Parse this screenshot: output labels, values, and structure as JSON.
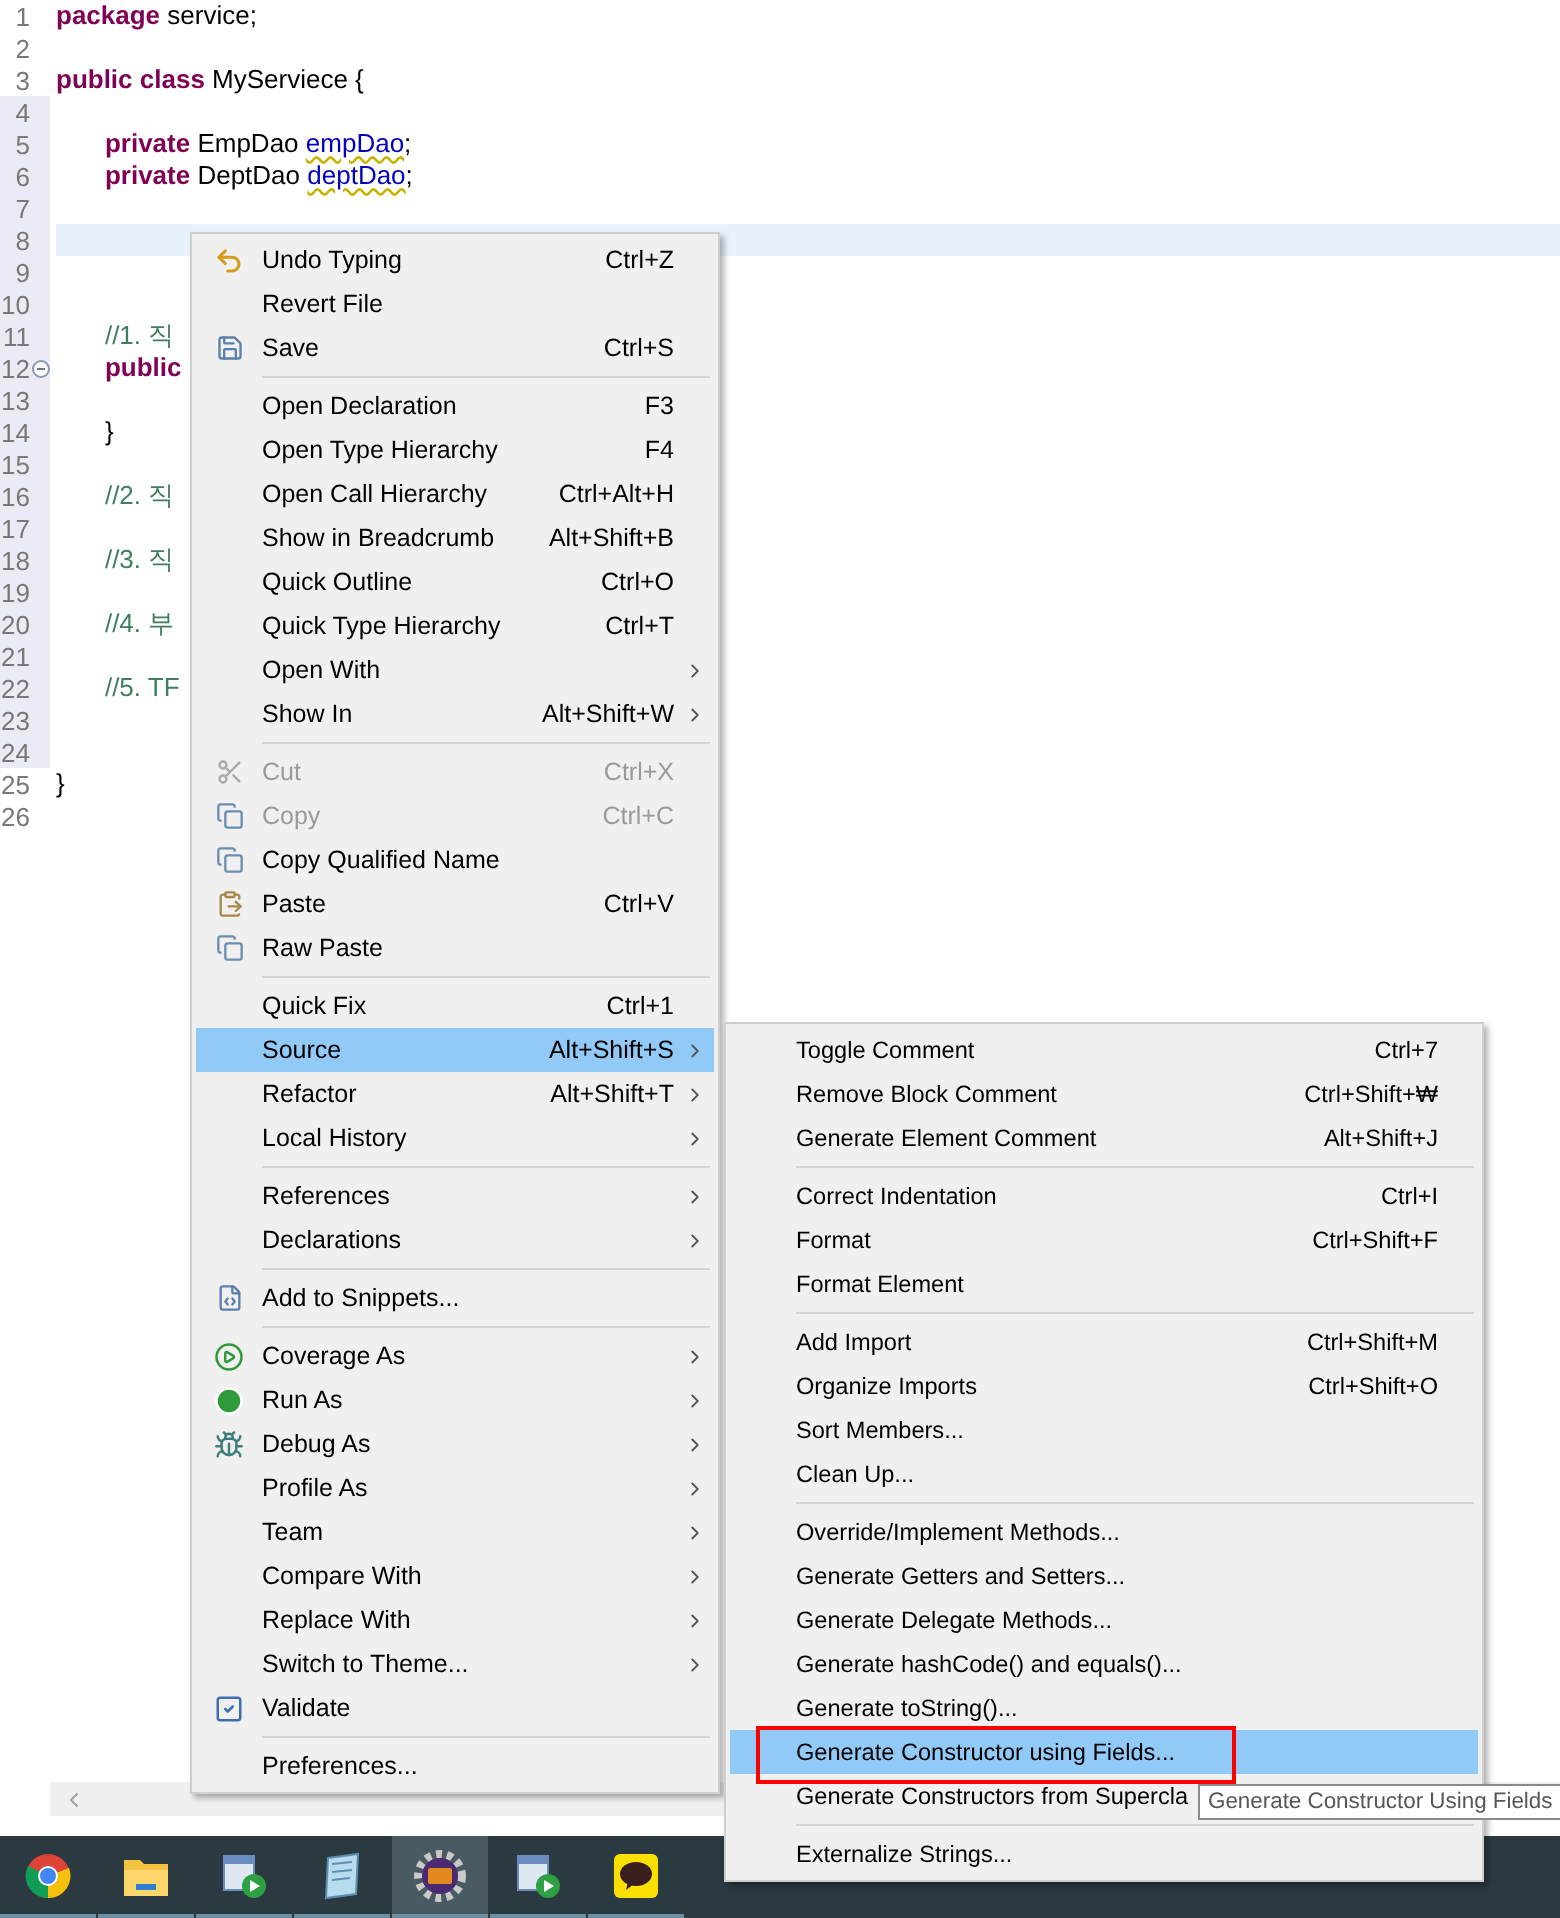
{
  "editor": {
    "lines": [
      {
        "number": "1",
        "changed": false,
        "current": false,
        "fold": false,
        "tokens": [
          {
            "text": "package",
            "kind": "keyword"
          },
          {
            "text": " service;",
            "kind": "plain"
          }
        ]
      },
      {
        "number": "2",
        "changed": false,
        "current": false,
        "fold": false
      },
      {
        "number": "3",
        "changed": false,
        "current": false,
        "fold": false,
        "tokens": [
          {
            "text": "public class",
            "kind": "keyword"
          },
          {
            "text": " MyServiece {",
            "kind": "plain"
          }
        ]
      },
      {
        "number": "4",
        "changed": true,
        "current": false,
        "fold": false
      },
      {
        "number": "5",
        "changed": true,
        "current": false,
        "fold": false,
        "tokens": [
          {
            "text": "\tprivate",
            "kind": "keyword"
          },
          {
            "text": " EmpDao ",
            "kind": "plain"
          },
          {
            "text": "empDao",
            "kind": "warn-field"
          },
          {
            "text": ";",
            "kind": "plain"
          }
        ]
      },
      {
        "number": "6",
        "changed": true,
        "current": false,
        "fold": false,
        "tokens": [
          {
            "text": "\tprivate",
            "kind": "keyword"
          },
          {
            "text": " DeptDao ",
            "kind": "plain"
          },
          {
            "text": "deptDao",
            "kind": "warn-field"
          },
          {
            "text": ";",
            "kind": "plain"
          }
        ]
      },
      {
        "number": "7",
        "changed": true,
        "current": false,
        "fold": false
      },
      {
        "number": "8",
        "changed": true,
        "current": true,
        "fold": false
      },
      {
        "number": "9",
        "changed": true,
        "current": false,
        "fold": false
      },
      {
        "number": "10",
        "changed": true,
        "current": false,
        "fold": false
      },
      {
        "number": "11",
        "changed": true,
        "current": false,
        "fold": false,
        "tokens": [
          {
            "text": "\t//1. 직",
            "kind": "comment"
          }
        ]
      },
      {
        "number": "12",
        "changed": true,
        "current": false,
        "fold": true,
        "tokens": [
          {
            "text": "\tpublic",
            "kind": "keyword"
          }
        ]
      },
      {
        "number": "13",
        "changed": true,
        "current": false,
        "fold": false
      },
      {
        "number": "14",
        "changed": true,
        "current": false,
        "fold": false,
        "tokens": [
          {
            "text": "\t}",
            "kind": "plain"
          }
        ]
      },
      {
        "number": "15",
        "changed": true,
        "current": false,
        "fold": false
      },
      {
        "number": "16",
        "changed": true,
        "current": false,
        "fold": false,
        "tokens": [
          {
            "text": "\t//2. 직",
            "kind": "comment"
          }
        ]
      },
      {
        "number": "17",
        "changed": true,
        "current": false,
        "fold": false
      },
      {
        "number": "18",
        "changed": true,
        "current": false,
        "fold": false,
        "tokens": [
          {
            "text": "\t//3. 직",
            "kind": "comment"
          }
        ]
      },
      {
        "number": "19",
        "changed": true,
        "current": false,
        "fold": false
      },
      {
        "number": "20",
        "changed": true,
        "current": false,
        "fold": false,
        "tokens": [
          {
            "text": "\t//4. 부",
            "kind": "comment"
          }
        ]
      },
      {
        "number": "21",
        "changed": true,
        "current": false,
        "fold": false
      },
      {
        "number": "22",
        "changed": true,
        "current": false,
        "fold": false,
        "tokens": [
          {
            "text": "\t//5. TF",
            "kind": "comment"
          }
        ]
      },
      {
        "number": "23",
        "changed": true,
        "current": false,
        "fold": false
      },
      {
        "number": "24",
        "changed": true,
        "current": false,
        "fold": false
      },
      {
        "number": "25",
        "changed": false,
        "current": false,
        "fold": false,
        "tokens": [
          {
            "text": "}",
            "kind": "plain"
          }
        ]
      },
      {
        "number": "26",
        "changed": false,
        "current": false,
        "fold": false
      }
    ]
  },
  "context_menu": [
    {
      "kind": "item",
      "label": "Undo Typing",
      "shortcut": "Ctrl+Z",
      "disabled": false,
      "selected": false,
      "submenu": false
    },
    {
      "kind": "item",
      "label": "Revert File",
      "disabled": false,
      "selected": false,
      "submenu": false
    },
    {
      "kind": "item",
      "label": "Save",
      "shortcut": "Ctrl+S",
      "disabled": false,
      "selected": false,
      "submenu": false
    },
    {
      "kind": "separator"
    },
    {
      "kind": "item",
      "label": "Open Declaration",
      "shortcut": "F3",
      "disabled": false,
      "selected": false,
      "submenu": false
    },
    {
      "kind": "item",
      "label": "Open Type Hierarchy",
      "shortcut": "F4",
      "disabled": false,
      "selected": false,
      "submenu": false
    },
    {
      "kind": "item",
      "label": "Open Call Hierarchy",
      "shortcut": "Ctrl+Alt+H",
      "disabled": false,
      "selected": false,
      "submenu": false
    },
    {
      "kind": "item",
      "label": "Show in Breadcrumb",
      "shortcut": "Alt+Shift+B",
      "disabled": false,
      "selected": false,
      "submenu": false
    },
    {
      "kind": "item",
      "label": "Quick Outline",
      "shortcut": "Ctrl+O",
      "disabled": false,
      "selected": false,
      "submenu": false
    },
    {
      "kind": "item",
      "label": "Quick Type Hierarchy",
      "shortcut": "Ctrl+T",
      "disabled": false,
      "selected": false,
      "submenu": false
    },
    {
      "kind": "item",
      "label": "Open With",
      "disabled": false,
      "selected": false,
      "submenu": true
    },
    {
      "kind": "item",
      "label": "Show In",
      "shortcut": "Alt+Shift+W",
      "disabled": false,
      "selected": false,
      "submenu": true
    },
    {
      "kind": "separator"
    },
    {
      "kind": "item",
      "label": "Cut",
      "shortcut": "Ctrl+X",
      "disabled": true,
      "selected": false,
      "submenu": false
    },
    {
      "kind": "item",
      "label": "Copy",
      "shortcut": "Ctrl+C",
      "disabled": true,
      "selected": false,
      "submenu": false
    },
    {
      "kind": "item",
      "label": "Copy Qualified Name",
      "disabled": false,
      "selected": false,
      "submenu": false
    },
    {
      "kind": "item",
      "label": "Paste",
      "shortcut": "Ctrl+V",
      "disabled": false,
      "selected": false,
      "submenu": false
    },
    {
      "kind": "item",
      "label": "Raw Paste",
      "disabled": false,
      "selected": false,
      "submenu": false
    },
    {
      "kind": "separator"
    },
    {
      "kind": "item",
      "label": "Quick Fix",
      "shortcut": "Ctrl+1",
      "disabled": false,
      "selected": false,
      "submenu": false
    },
    {
      "kind": "item",
      "label": "Source",
      "shortcut": "Alt+Shift+S",
      "disabled": false,
      "selected": true,
      "submenu": true
    },
    {
      "kind": "item",
      "label": "Refactor",
      "shortcut": "Alt+Shift+T",
      "disabled": false,
      "selected": false,
      "submenu": true
    },
    {
      "kind": "item",
      "label": "Local History",
      "disabled": false,
      "selected": false,
      "submenu": true
    },
    {
      "kind": "separator"
    },
    {
      "kind": "item",
      "label": "References",
      "disabled": false,
      "selected": false,
      "submenu": true
    },
    {
      "kind": "item",
      "label": "Declarations",
      "disabled": false,
      "selected": false,
      "submenu": true
    },
    {
      "kind": "separator"
    },
    {
      "kind": "item",
      "label": "Add to Snippets...",
      "disabled": false,
      "selected": false,
      "submenu": false
    },
    {
      "kind": "separator"
    },
    {
      "kind": "item",
      "label": "Coverage As",
      "disabled": false,
      "selected": false,
      "submenu": true
    },
    {
      "kind": "item",
      "label": "Run As",
      "disabled": false,
      "selected": false,
      "submenu": true
    },
    {
      "kind": "item",
      "label": "Debug As",
      "disabled": false,
      "selected": false,
      "submenu": true
    },
    {
      "kind": "item",
      "label": "Profile As",
      "disabled": false,
      "selected": false,
      "submenu": true
    },
    {
      "kind": "item",
      "label": "Team",
      "disabled": false,
      "selected": false,
      "submenu": true
    },
    {
      "kind": "item",
      "label": "Compare With",
      "disabled": false,
      "selected": false,
      "submenu": true
    },
    {
      "kind": "item",
      "label": "Replace With",
      "disabled": false,
      "selected": false,
      "submenu": true
    },
    {
      "kind": "item",
      "label": "Switch to Theme...",
      "disabled": false,
      "selected": false,
      "submenu": true
    },
    {
      "kind": "check",
      "label": "Validate",
      "checked": true,
      "disabled": false,
      "selected": false,
      "submenu": false
    },
    {
      "kind": "separator"
    },
    {
      "kind": "item",
      "label": "Preferences...",
      "disabled": false,
      "selected": false,
      "submenu": false
    }
  ],
  "source_submenu": [
    {
      "kind": "item",
      "label": "Toggle Comment",
      "shortcut": "Ctrl+7",
      "selected": false
    },
    {
      "kind": "item",
      "label": "Remove Block Comment",
      "shortcut": "Ctrl+Shift+₩",
      "selected": false
    },
    {
      "kind": "item",
      "label": "Generate Element Comment",
      "shortcut": "Alt+Shift+J",
      "selected": false
    },
    {
      "kind": "separator"
    },
    {
      "kind": "item",
      "label": "Correct Indentation",
      "shortcut": "Ctrl+I",
      "selected": false
    },
    {
      "kind": "item",
      "label": "Format",
      "shortcut": "Ctrl+Shift+F",
      "selected": false
    },
    {
      "kind": "item",
      "label": "Format Element",
      "selected": false
    },
    {
      "kind": "separator"
    },
    {
      "kind": "item",
      "label": "Add Import",
      "shortcut": "Ctrl+Shift+M",
      "selected": false
    },
    {
      "kind": "item",
      "label": "Organize Imports",
      "shortcut": "Ctrl+Shift+O",
      "selected": false
    },
    {
      "kind": "item",
      "label": "Sort Members...",
      "selected": false
    },
    {
      "kind": "item",
      "label": "Clean Up...",
      "selected": false
    },
    {
      "kind": "separator"
    },
    {
      "kind": "item",
      "label": "Override/Implement Methods...",
      "selected": false
    },
    {
      "kind": "item",
      "label": "Generate Getters and Setters...",
      "selected": false
    },
    {
      "kind": "item",
      "label": "Generate Delegate Methods...",
      "selected": false
    },
    {
      "kind": "item",
      "label": "Generate hashCode() and equals()...",
      "selected": false
    },
    {
      "kind": "item",
      "label": "Generate toString()...",
      "selected": false
    },
    {
      "kind": "item",
      "label": "Generate Constructor using Fields...",
      "selected": true
    },
    {
      "kind": "item",
      "label": "Generate Constructors from Supercla",
      "selected": false
    },
    {
      "kind": "separator"
    },
    {
      "kind": "item",
      "label": "Externalize Strings...",
      "selected": false
    }
  ],
  "tooltip": "Generate Constructor Using Fields",
  "taskbar": [
    {
      "kind": "browser",
      "selected": false
    },
    {
      "kind": "folder",
      "selected": false
    },
    {
      "kind": "media",
      "selected": false
    },
    {
      "kind": "notepad",
      "selected": false
    },
    {
      "kind": "ide",
      "selected": true
    },
    {
      "kind": "media",
      "selected": false
    },
    {
      "kind": "chat",
      "selected": false
    }
  ]
}
